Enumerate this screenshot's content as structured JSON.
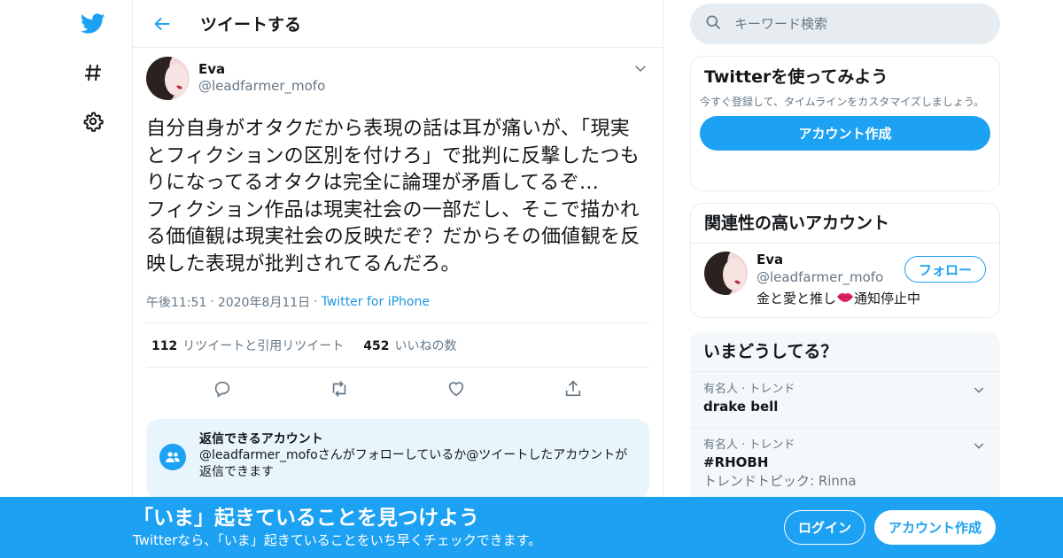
{
  "colors": {
    "accent": "#1da1f2",
    "text": "#14171a",
    "secondary": "#657786",
    "border": "#e6ecf0"
  },
  "nav": {
    "icons": [
      "twitter-bird-icon",
      "hashtag-icon",
      "gear-icon"
    ]
  },
  "header": {
    "title": "ツイートする",
    "back_icon": "arrow-left-icon"
  },
  "tweet": {
    "author": {
      "name": "Eva",
      "handle": "@leadfarmer_mofo"
    },
    "text": "自分自身がオタクだから表現の話は耳が痛いが、「現実とフィクションの区別を付けろ」で批判に反撃したつもりになってるオタクは完全に論理が矛盾してるぞ…\nフィクション作品は現実社会の一部だし、そこで描かれる価値観は現実社会の反映だぞ？だからその価値観を反映した表現が批判されてるんだろ。",
    "time": "午後11:51",
    "date": "2020年8月11日",
    "source": "Twitter for iPhone",
    "separator": "·",
    "stats": {
      "retweets_count": "112",
      "retweets_label": "リツイートと引用リツイート",
      "likes_count": "452",
      "likes_label": "いいねの数"
    },
    "actions": [
      "reply-icon",
      "retweet-icon",
      "like-icon",
      "share-icon"
    ]
  },
  "reply_notice": {
    "title": "返信できるアカウント",
    "description": "@leadfarmer_mofoさんがフォローしているか@ツイートしたアカウントが返信できます"
  },
  "search": {
    "placeholder": "キーワード検索"
  },
  "signup_card": {
    "title": "Twitterを使ってみよう",
    "description": "今すぐ登録して、タイムラインをカスタマイズしましょう。",
    "button": "アカウント作成"
  },
  "related": {
    "title": "関連性の高いアカウント",
    "user": {
      "name": "Eva",
      "handle": "@leadfarmer_mofo",
      "bio_prefix": "金と愛と推し",
      "bio_suffix": "通知停止中",
      "follow_button": "フォロー"
    }
  },
  "trends": {
    "title": "いまどうしてる？",
    "items": [
      {
        "category": "有名人 · トレンド",
        "name": "drake bell",
        "extra": ""
      },
      {
        "category": "有名人 · トレンド",
        "name": "#RHOBH",
        "extra": "トレンドトピック: Rinna"
      }
    ]
  },
  "banner": {
    "title": "「いま」起きていることを見つけよう",
    "subtitle": "Twitterなら、「いま」起きていることをいち早くチェックできます。",
    "login": "ログイン",
    "signup": "アカウント作成"
  }
}
